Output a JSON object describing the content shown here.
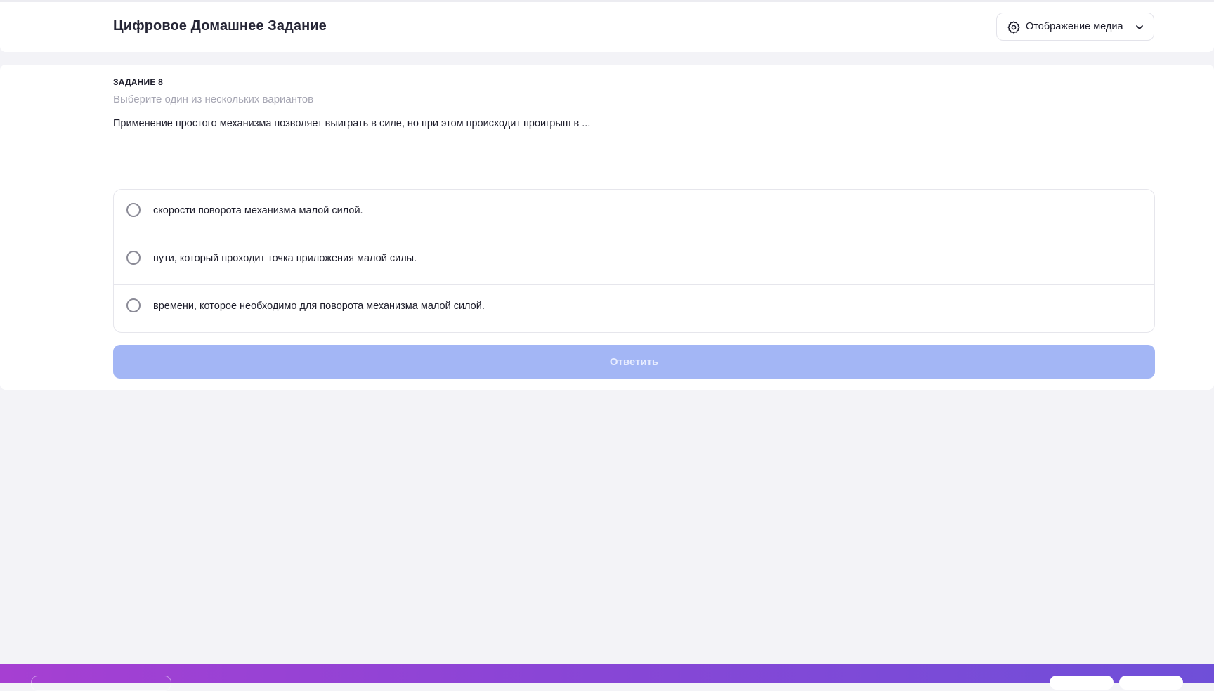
{
  "header": {
    "title": "Цифровое Домашнее Задание",
    "media_button": {
      "label": "Отображение медиа",
      "icon": "gear-icon",
      "dropdown_icon": "chevron-down-icon"
    }
  },
  "task": {
    "number": "ЗАДАНИЕ 8",
    "hint": "Выберите один из нескольких вариантов",
    "question": "Применение простого механизма позволяет выиграть в силе, но при этом происходит проигрыш в ...",
    "options": [
      {
        "label": "скорости поворота механизма малой силой.",
        "selected": false
      },
      {
        "label": "пути, который проходит точка приложения малой силы.",
        "selected": false
      },
      {
        "label": "времени, которое необходимо для поворота механизма малой силой.",
        "selected": false
      }
    ],
    "submit_label": "Ответить",
    "submit_enabled": false
  },
  "colors": {
    "accent_disabled": "#a3b6f5",
    "bottom_bar_gradient": [
      "#a63fd2",
      "#6f4fd8"
    ],
    "background": "#f3f3f7"
  }
}
